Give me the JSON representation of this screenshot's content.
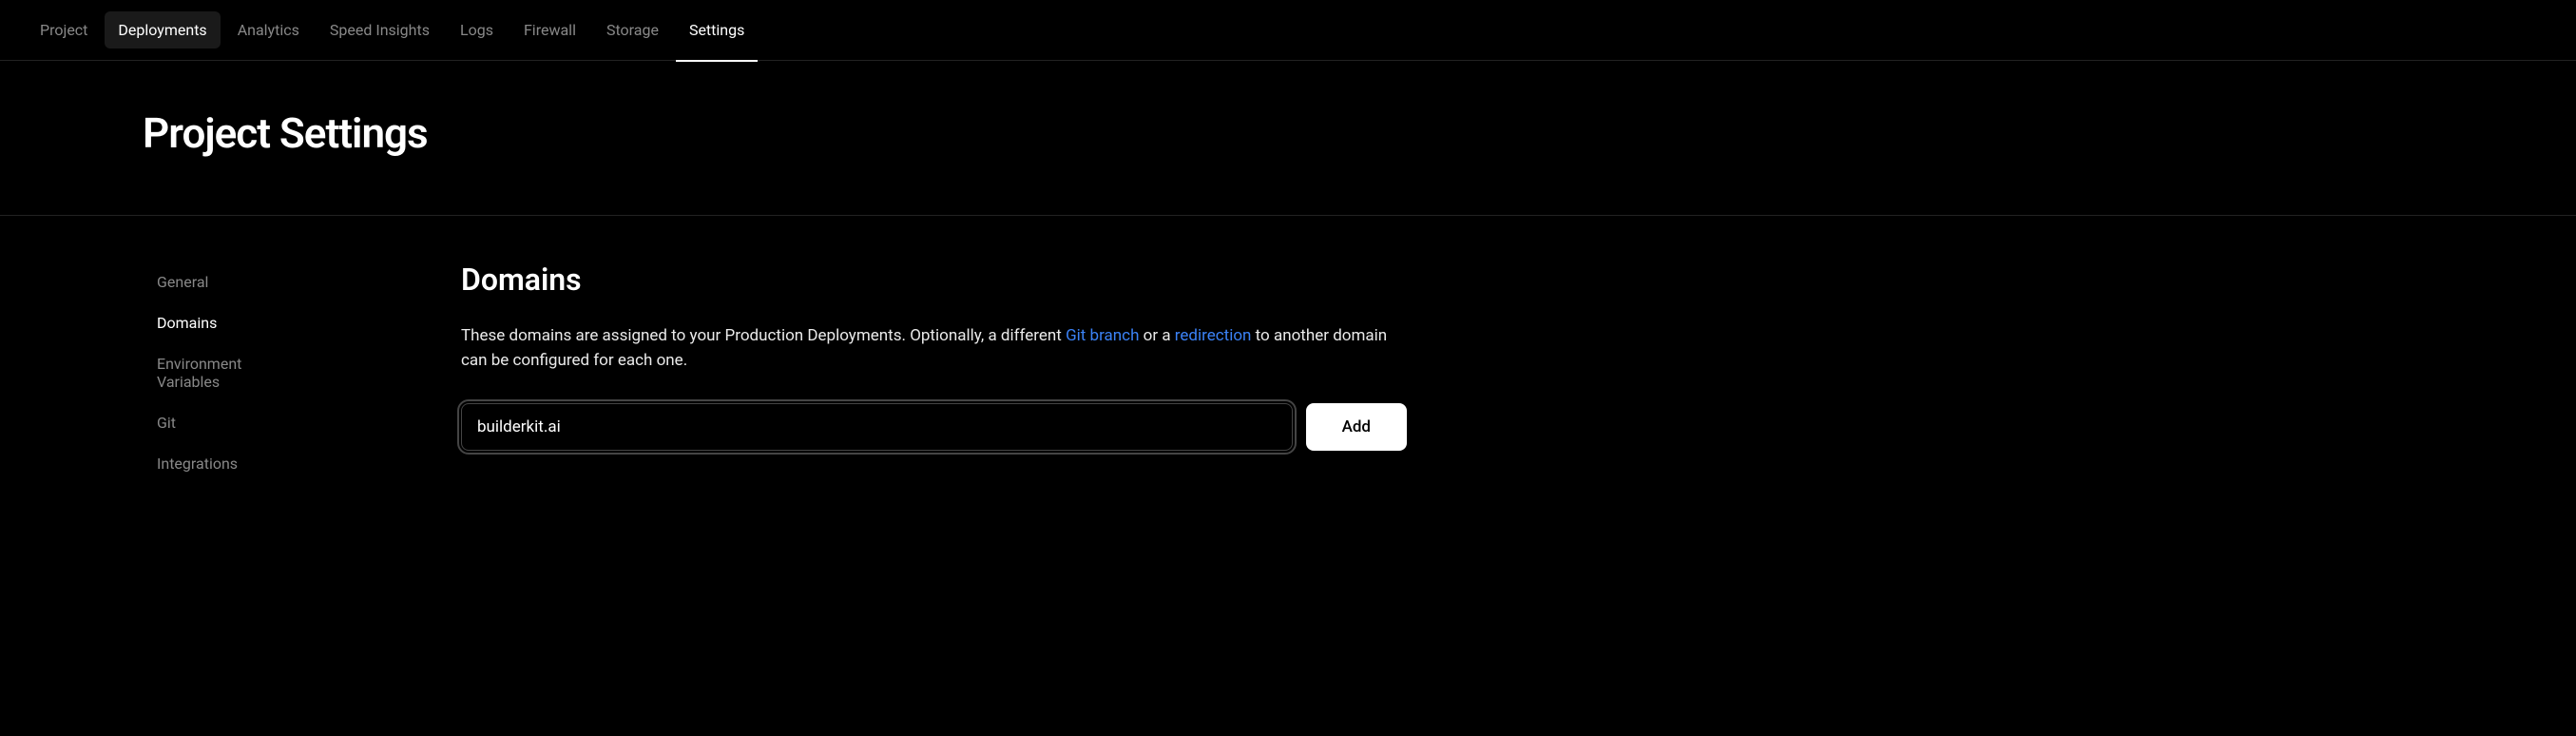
{
  "nav": {
    "items": [
      {
        "label": "Project",
        "state": "default"
      },
      {
        "label": "Deployments",
        "state": "highlighted"
      },
      {
        "label": "Analytics",
        "state": "default"
      },
      {
        "label": "Speed Insights",
        "state": "default"
      },
      {
        "label": "Logs",
        "state": "default"
      },
      {
        "label": "Firewall",
        "state": "default"
      },
      {
        "label": "Storage",
        "state": "default"
      },
      {
        "label": "Settings",
        "state": "active"
      }
    ]
  },
  "header": {
    "title": "Project Settings"
  },
  "sidebar": {
    "items": [
      {
        "label": "General",
        "active": false
      },
      {
        "label": "Domains",
        "active": true
      },
      {
        "label": "Environment Variables",
        "active": false
      },
      {
        "label": "Git",
        "active": false
      },
      {
        "label": "Integrations",
        "active": false
      }
    ]
  },
  "main": {
    "section_title": "Domains",
    "description_part1": "These domains are assigned to your Production Deployments. Optionally, a different ",
    "link1": "Git branch",
    "description_part2": " or a ",
    "link2": "redirection",
    "description_part3": " to another domain can be configured for each one.",
    "input_value": "builderkit.ai",
    "add_button": "Add"
  }
}
